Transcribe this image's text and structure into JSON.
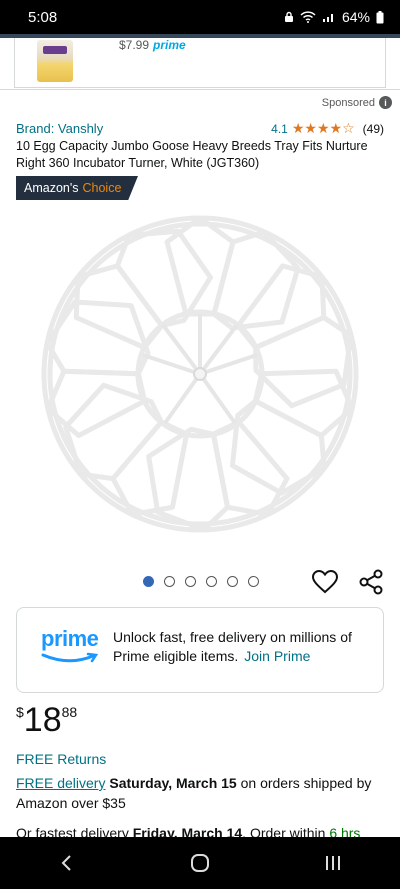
{
  "status": {
    "time": "5:08",
    "battery": "64%"
  },
  "ad": {
    "price": "$7.99",
    "prime": "prime"
  },
  "sponsored": {
    "label": "Sponsored",
    "info": "i"
  },
  "product": {
    "brand": "Brand: Vanshly",
    "rating_value": "4.1",
    "rating_stars": 4.1,
    "rating_count": "(49)",
    "title": "10 Egg Capacity Jumbo Goose Heavy Breeds Tray Fits Nurture Right 360 Incubator Turner, White (JGT360)",
    "badge_prefix": "Amazon's",
    "badge_highlight": "Choice",
    "image_count": 6,
    "active_image_index": 0
  },
  "prime": {
    "logo_text": "prime",
    "message": "Unlock fast, free delivery on millions of Prime eligible items.",
    "join_label": "Join Prime"
  },
  "price": {
    "symbol": "$",
    "whole": "18",
    "fraction": "88"
  },
  "delivery": {
    "free_returns": "FREE Returns",
    "free_delivery_link": "FREE delivery",
    "date": "Saturday, March 15",
    "condition": "on orders shipped by Amazon over $35",
    "fastest_prefix": "Or fastest delivery",
    "fastest_date": "Friday, March 14",
    "order_within": "Order within",
    "time_left": "6 hrs"
  },
  "colors": {
    "link": "#007185",
    "star": "#de7921",
    "badge_bg": "#232f3e",
    "badge_accent": "#f08804",
    "prime_blue": "#1a98ff",
    "dot_active": "#3468b6"
  }
}
